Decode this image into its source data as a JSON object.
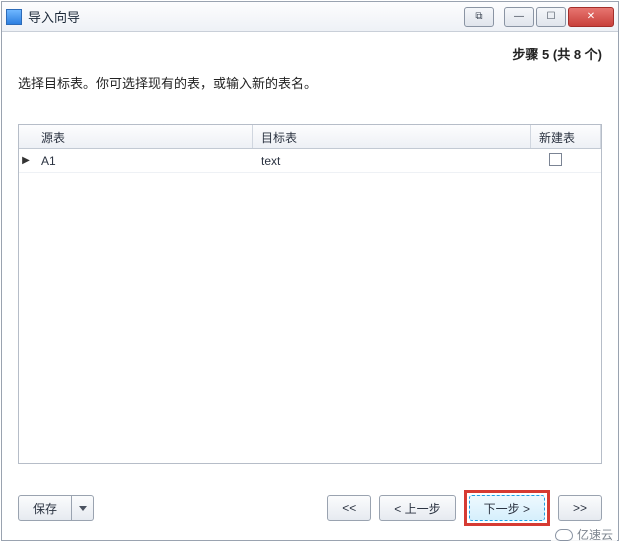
{
  "window": {
    "title": "导入向导"
  },
  "step": {
    "label": "步骤 5 (共 8 个)"
  },
  "instruction": "选择目标表。你可选择现有的表，或输入新的表名。",
  "grid": {
    "headers": {
      "source": "源表",
      "target": "目标表",
      "create": "新建表"
    },
    "rows": [
      {
        "source": "A1",
        "target": "text",
        "create": false
      }
    ]
  },
  "footer": {
    "save": "保存",
    "first": "<<",
    "prev": "< 上一步",
    "next": "下一步 >",
    "last": ">>"
  },
  "watermark": "亿速云"
}
